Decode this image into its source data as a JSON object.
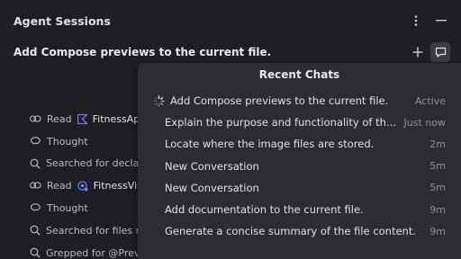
{
  "header": {
    "title": "Agent Sessions",
    "more_icon": "kebab-menu-icon",
    "minimize_icon": "minimize-icon"
  },
  "session": {
    "title": "Add Compose previews to the current file.",
    "add_icon": "plus-icon",
    "history_icon": "chat-history-icon"
  },
  "steps": [
    {
      "icon": "read-icon",
      "label": "Read",
      "file_icon": "kotlin-file-icon",
      "file": "FitnessApp"
    },
    {
      "icon": "thought-icon",
      "label": "Thought"
    },
    {
      "icon": "search-icon",
      "label": "Searched for declara"
    },
    {
      "icon": "read-icon",
      "label": "Read",
      "file_icon": "compose-file-icon",
      "file": "FitnessView"
    },
    {
      "icon": "thought-icon",
      "label": "Thought"
    },
    {
      "icon": "search-icon",
      "label": "Searched for files m"
    },
    {
      "icon": "search-icon",
      "label": "Grepped for @Previe"
    }
  ],
  "recent_chats": {
    "title": "Recent Chats",
    "items": [
      {
        "title": "Add Compose previews to the current file.",
        "time": "Active",
        "icon": "loading-spinner-icon"
      },
      {
        "title": "Explain the purpose and functionality of the...",
        "time": "Just now"
      },
      {
        "title": "Locate where the image files are stored.",
        "time": "2m"
      },
      {
        "title": "New Conversation",
        "time": "5m"
      },
      {
        "title": "New Conversation",
        "time": "5m"
      },
      {
        "title": "Add documentation to the current file.",
        "time": "9m"
      },
      {
        "title": "Generate a concise summary of the file content.",
        "time": "9m"
      }
    ]
  },
  "colors": {
    "background": "#1e1f22",
    "popup": "#2b2d30",
    "text": "#dfe1e5",
    "muted": "#8d9096",
    "kotlin_purple": "#8f6cf7",
    "compose_blue": "#4e8df5"
  }
}
